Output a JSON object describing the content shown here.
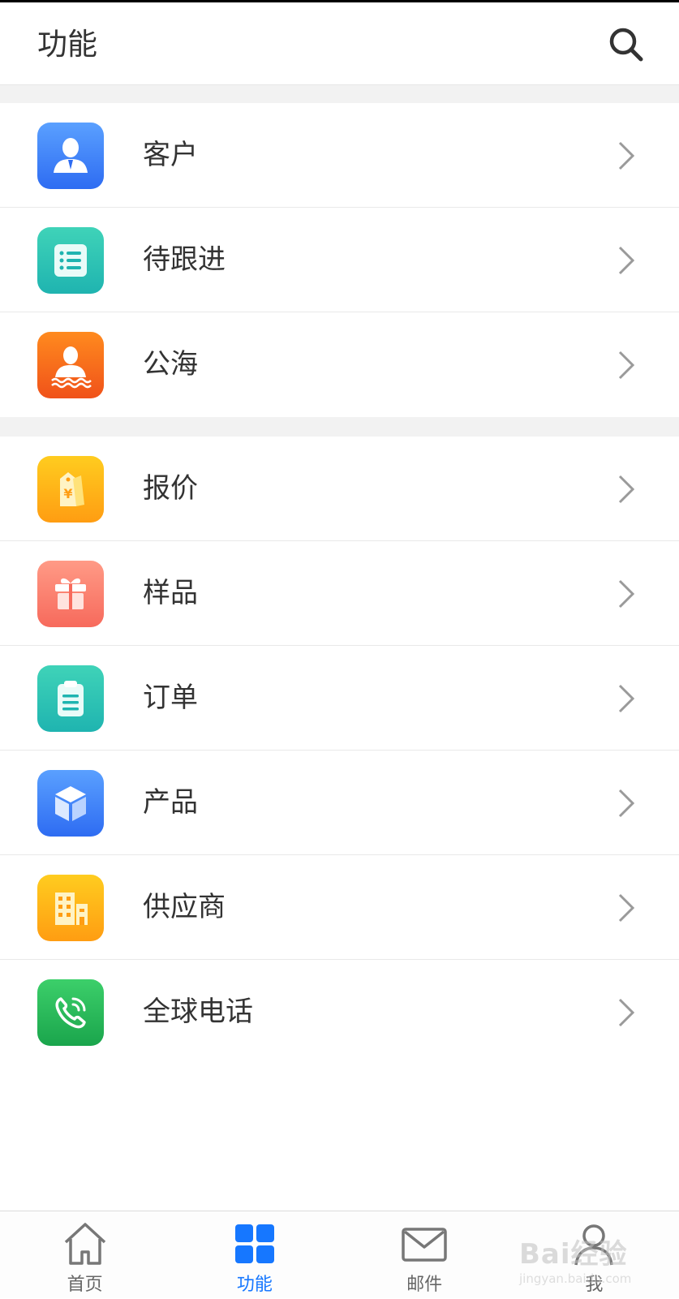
{
  "header": {
    "title": "功能"
  },
  "groups": [
    {
      "items": [
        {
          "label": "客户",
          "icon": "customer-icon"
        },
        {
          "label": "待跟进",
          "icon": "follow-up-list-icon"
        },
        {
          "label": "公海",
          "icon": "public-pool-icon"
        }
      ]
    },
    {
      "items": [
        {
          "label": "报价",
          "icon": "quote-tag-icon"
        },
        {
          "label": "样品",
          "icon": "gift-icon"
        },
        {
          "label": "订单",
          "icon": "clipboard-icon"
        },
        {
          "label": "产品",
          "icon": "cube-icon"
        },
        {
          "label": "供应商",
          "icon": "building-icon"
        },
        {
          "label": "全球电话",
          "icon": "phone-icon"
        }
      ]
    }
  ],
  "tabbar": {
    "tabs": [
      {
        "label": "首页",
        "icon": "home-icon",
        "active": false
      },
      {
        "label": "功能",
        "icon": "grid-icon",
        "active": true
      },
      {
        "label": "邮件",
        "icon": "mail-icon",
        "active": false
      },
      {
        "label": "我",
        "icon": "user-icon",
        "active": false
      }
    ]
  },
  "watermark": {
    "text": "Bai经验",
    "sub": "jingyan.baidu.com"
  },
  "colors": {
    "accent": "#1677ff",
    "blue": "#2e6cf2",
    "teal": "#1fb4b0",
    "orange": "#f0521a",
    "yellow": "#ff9d12",
    "salmon": "#f76a5c",
    "green": "#1aa54c"
  }
}
